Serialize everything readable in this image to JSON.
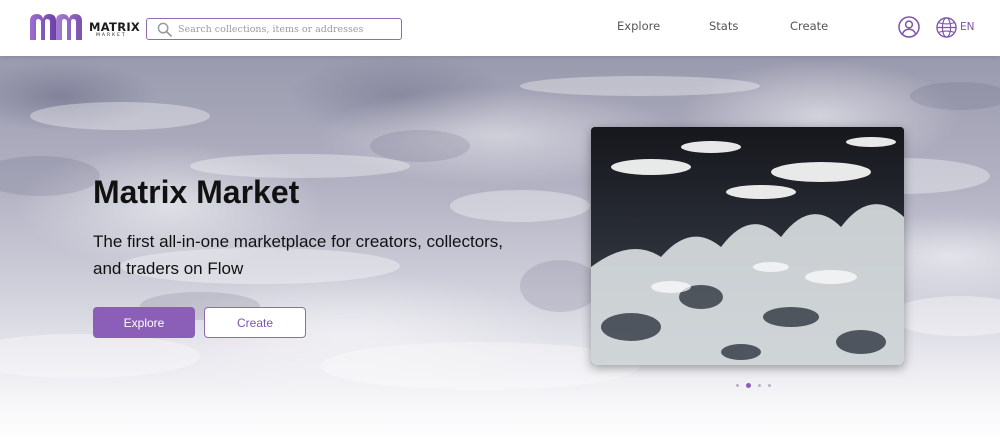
{
  "header": {
    "logo": {
      "mark": "MM",
      "word": "MATRIX",
      "sub": "MARKET"
    },
    "search": {
      "placeholder": "Search collections, items or addresses",
      "value": ""
    },
    "nav": [
      {
        "label": "Explore"
      },
      {
        "label": "Stats"
      },
      {
        "label": "Create"
      }
    ],
    "language": {
      "label": "EN"
    }
  },
  "hero": {
    "title": "Matrix Market",
    "subtitle": "The first all-in-one marketplace for creators, collectors, and traders on Flow",
    "buttons": {
      "explore": "Explore",
      "create": "Create"
    },
    "carousel": {
      "slide_count": 4,
      "active_index": 1
    }
  },
  "colors": {
    "accent": "#8b5fb8",
    "accent_border": "#8f6bb7",
    "text_dark": "#111111",
    "nav_text": "#555555"
  },
  "icons": [
    "logo-mark",
    "search-icon",
    "account-icon",
    "globe-icon"
  ]
}
